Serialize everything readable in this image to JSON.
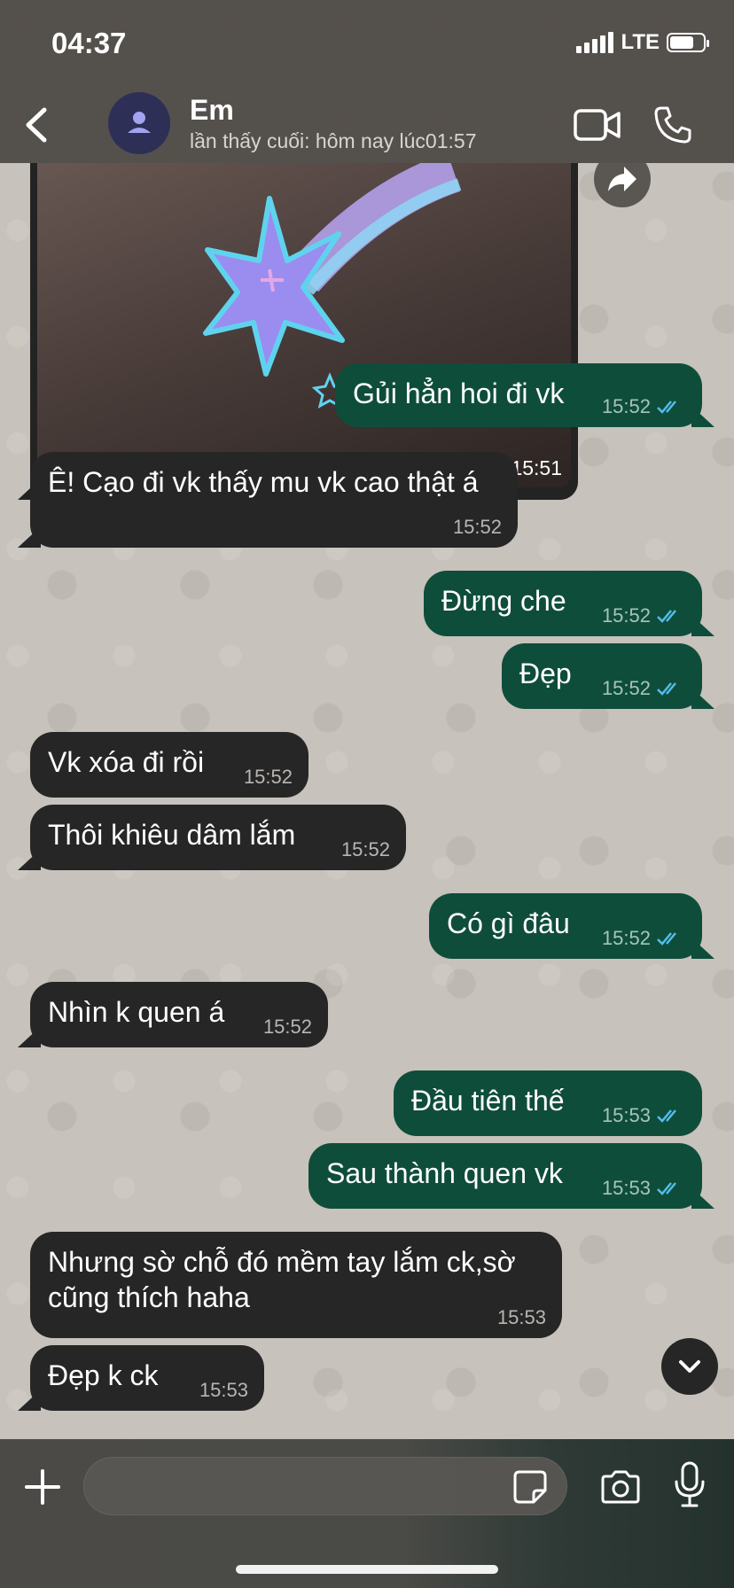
{
  "status": {
    "time": "04:37",
    "network": "LTE"
  },
  "header": {
    "contact_name": "Em",
    "last_seen": "lần thấy cuối: hôm nay lúc01:57"
  },
  "media_message": {
    "time": "15:51"
  },
  "messages": [
    {
      "dir": "out",
      "text": "Gủi hẳn hoi đi vk",
      "time": "15:52"
    },
    {
      "dir": "in",
      "text": "Ê! Cạo đi vk thấy mu vk cao thật á",
      "time": "15:52"
    },
    {
      "dir": "out",
      "text": "Đừng che",
      "time": "15:52"
    },
    {
      "dir": "out",
      "text": "Đẹp",
      "time": "15:52"
    },
    {
      "dir": "in",
      "text": "Vk xóa đi rồi",
      "time": "15:52"
    },
    {
      "dir": "in",
      "text": "Thôi khiêu dâm lắm",
      "time": "15:52"
    },
    {
      "dir": "out",
      "text": "Có gì đâu",
      "time": "15:52"
    },
    {
      "dir": "in",
      "text": "Nhìn k quen á",
      "time": "15:52"
    },
    {
      "dir": "out",
      "text": "Đầu tiên thế",
      "time": "15:53"
    },
    {
      "dir": "out",
      "text": "Sau thành quen vk",
      "time": "15:53"
    },
    {
      "dir": "in",
      "text": "Nhưng sờ chỗ đó mềm tay lắm ck,sờ\ncũng thích haha",
      "time": "15:53"
    },
    {
      "dir": "in",
      "text": "Đẹp k ck",
      "time": "15:53"
    }
  ],
  "input": {
    "value": "",
    "placeholder": ""
  },
  "colors": {
    "incoming": "#262626",
    "outgoing": "#0f4d3b",
    "read_ticks": "#53bdeb"
  },
  "icons": [
    "back-chevron-icon",
    "person-icon",
    "video-camera-icon",
    "phone-icon",
    "forward-icon",
    "chevron-down-icon",
    "plus-icon",
    "sticker-icon",
    "camera-icon",
    "microphone-icon",
    "double-check-icon"
  ]
}
